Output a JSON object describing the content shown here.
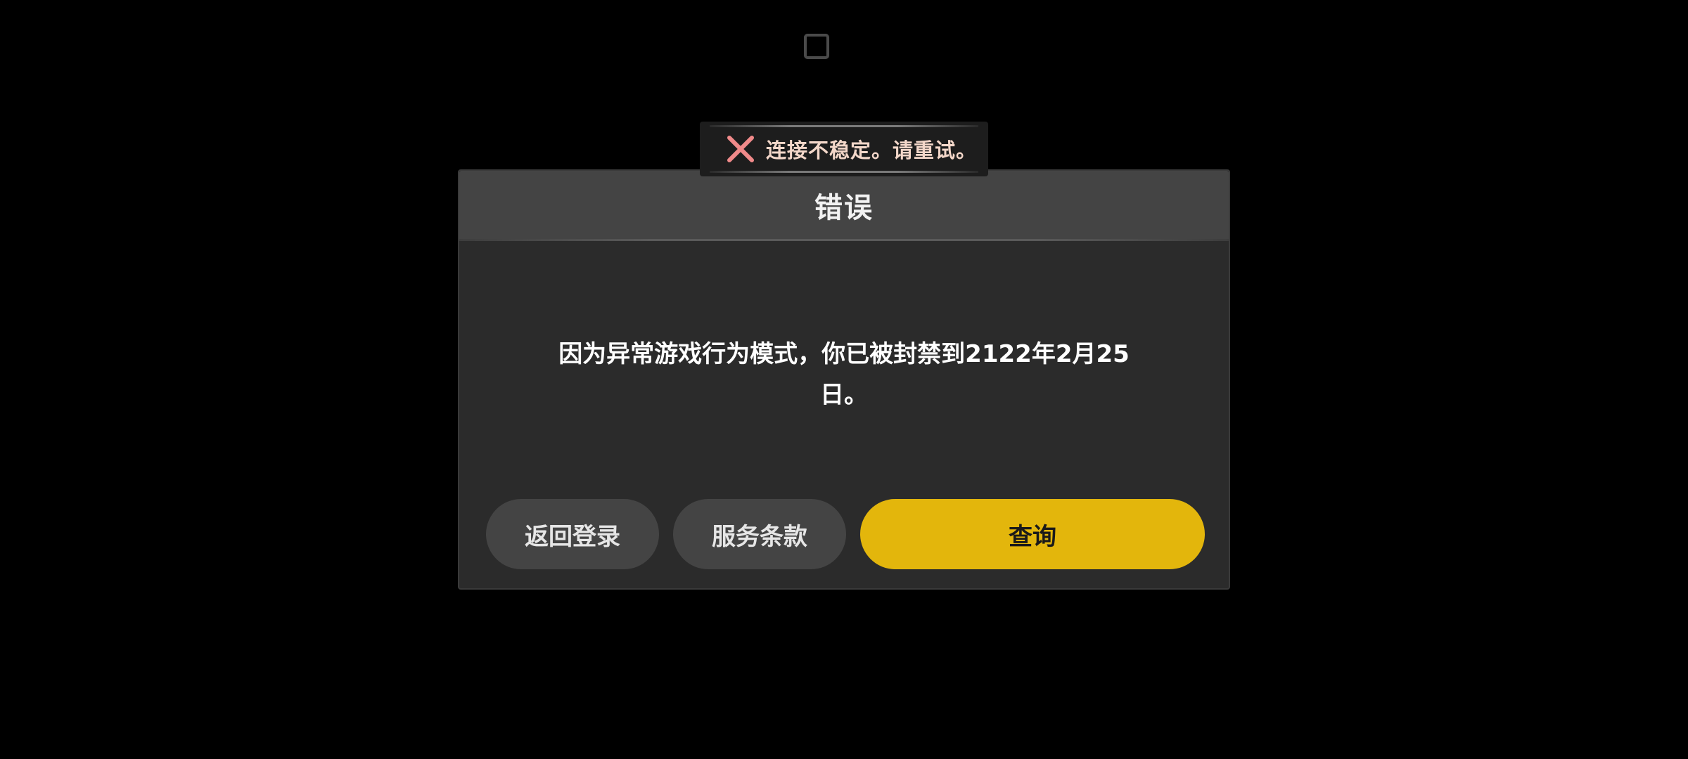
{
  "system": {
    "top_indicator_icon": "square-outline-icon"
  },
  "toast": {
    "icon": "close-x-icon",
    "icon_color": "#f08a8a",
    "message": "连接不稳定。请重试。"
  },
  "dialog": {
    "title": "错误",
    "message": "因为异常游戏行为模式，你已被封禁到2122年2月25日。",
    "buttons": {
      "back_to_login": "返回登录",
      "terms_of_service": "服务条款",
      "query": "查询"
    }
  },
  "colors": {
    "background": "#000000",
    "dialog_body": "#2b2b2b",
    "dialog_header": "#444444",
    "secondary_button": "#444444",
    "primary_button": "#e3b60c",
    "toast_background": "#1d1d1d"
  }
}
